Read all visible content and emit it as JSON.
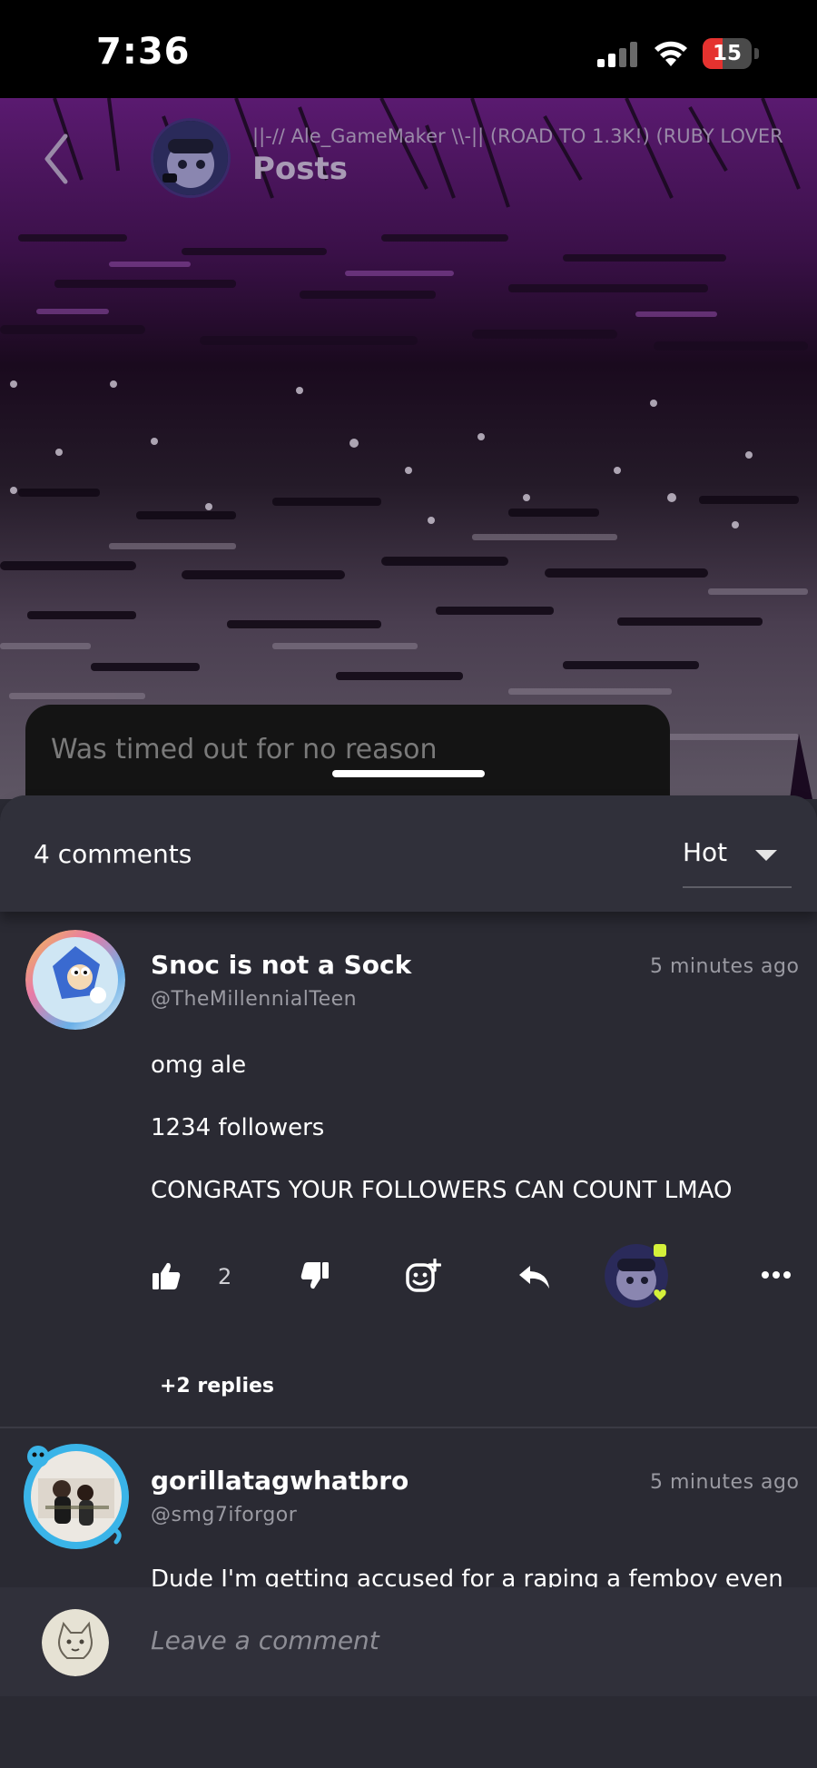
{
  "status_bar": {
    "time": "7:36",
    "battery": "15",
    "battery_color": "#e5322f"
  },
  "header": {
    "author_name": "||-// Ale_GameMaker \\\\-|| (ROAD TO 1.3K!) (RUBY LOVER",
    "title": "Posts"
  },
  "post": {
    "caption": "Was timed out for no reason"
  },
  "comments_header": {
    "count_label": "4 comments",
    "sort": {
      "selected": "Hot"
    }
  },
  "comments": [
    {
      "display_name": "Snoc is not a Sock",
      "handle": "@TheMillennialTeen",
      "time": "5 minutes ago",
      "lines": [
        "omg ale",
        "1234 followers",
        "CONGRATS YOUR FOLLOWERS CAN COUNT LMAO"
      ],
      "likes": "2",
      "replies_label": "+2 replies"
    },
    {
      "display_name": "gorillatagwhatbro",
      "handle": "@smg7iforgor",
      "time": "5 minutes ago",
      "lines": [
        "Dude I'm getting accused for a raping a femboy even"
      ]
    }
  ],
  "comment_input": {
    "placeholder": "Leave a comment"
  },
  "colors": {
    "panel": "#2a2a33",
    "header_panel": "#30303a",
    "accent_purple": "#5a1a70"
  },
  "icons": [
    "back-arrow-icon",
    "thumbs-up-icon",
    "thumbs-down-icon",
    "add-reaction-icon",
    "reply-icon",
    "more-icon"
  ]
}
